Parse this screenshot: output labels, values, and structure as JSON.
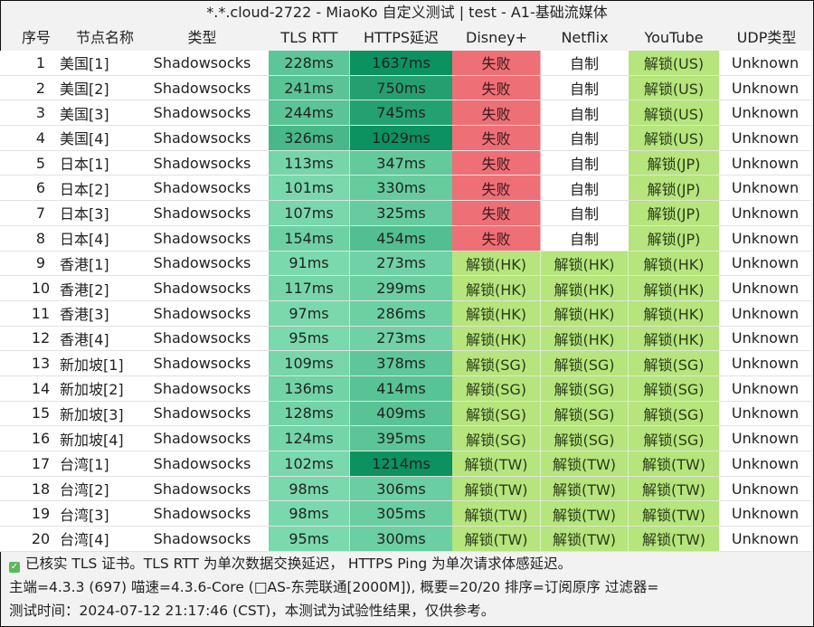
{
  "title": "*.*.cloud-2722 - MiaoKo 自定义测试 | test - A1-基础流媒体",
  "columns": [
    "序号",
    "节点名称",
    "类型",
    "TLS RTT",
    "HTTPS延迟",
    "Disney+",
    "Netflix",
    "YouTube",
    "UDP类型"
  ],
  "colors": {
    "fail": "#ef6f77",
    "unlock": "#b5e57c",
    "self_made": "#ffffff",
    "latency_low": "#7fdcb0",
    "latency_high": "#0c8f5e"
  },
  "rows": [
    {
      "idx": "1",
      "name": "美国[1]",
      "type": "Shadowsocks",
      "tls": "228ms",
      "tls_v": 228,
      "https": "1637ms",
      "https_v": 1637,
      "disney": "失败",
      "netflix": "自制",
      "youtube": "解锁(US)",
      "udp": "Unknown"
    },
    {
      "idx": "2",
      "name": "美国[2]",
      "type": "Shadowsocks",
      "tls": "241ms",
      "tls_v": 241,
      "https": "750ms",
      "https_v": 750,
      "disney": "失败",
      "netflix": "自制",
      "youtube": "解锁(US)",
      "udp": "Unknown"
    },
    {
      "idx": "3",
      "name": "美国[3]",
      "type": "Shadowsocks",
      "tls": "244ms",
      "tls_v": 244,
      "https": "745ms",
      "https_v": 745,
      "disney": "失败",
      "netflix": "自制",
      "youtube": "解锁(US)",
      "udp": "Unknown"
    },
    {
      "idx": "4",
      "name": "美国[4]",
      "type": "Shadowsocks",
      "tls": "326ms",
      "tls_v": 326,
      "https": "1029ms",
      "https_v": 1029,
      "disney": "失败",
      "netflix": "自制",
      "youtube": "解锁(US)",
      "udp": "Unknown"
    },
    {
      "idx": "5",
      "name": "日本[1]",
      "type": "Shadowsocks",
      "tls": "113ms",
      "tls_v": 113,
      "https": "347ms",
      "https_v": 347,
      "disney": "失败",
      "netflix": "自制",
      "youtube": "解锁(JP)",
      "udp": "Unknown"
    },
    {
      "idx": "6",
      "name": "日本[2]",
      "type": "Shadowsocks",
      "tls": "101ms",
      "tls_v": 101,
      "https": "330ms",
      "https_v": 330,
      "disney": "失败",
      "netflix": "自制",
      "youtube": "解锁(JP)",
      "udp": "Unknown"
    },
    {
      "idx": "7",
      "name": "日本[3]",
      "type": "Shadowsocks",
      "tls": "107ms",
      "tls_v": 107,
      "https": "325ms",
      "https_v": 325,
      "disney": "失败",
      "netflix": "自制",
      "youtube": "解锁(JP)",
      "udp": "Unknown"
    },
    {
      "idx": "8",
      "name": "日本[4]",
      "type": "Shadowsocks",
      "tls": "154ms",
      "tls_v": 154,
      "https": "454ms",
      "https_v": 454,
      "disney": "失败",
      "netflix": "自制",
      "youtube": "解锁(JP)",
      "udp": "Unknown"
    },
    {
      "idx": "9",
      "name": "香港[1]",
      "type": "Shadowsocks",
      "tls": "91ms",
      "tls_v": 91,
      "https": "273ms",
      "https_v": 273,
      "disney": "解锁(HK)",
      "netflix": "解锁(HK)",
      "youtube": "解锁(HK)",
      "udp": "Unknown"
    },
    {
      "idx": "10",
      "name": "香港[2]",
      "type": "Shadowsocks",
      "tls": "117ms",
      "tls_v": 117,
      "https": "299ms",
      "https_v": 299,
      "disney": "解锁(HK)",
      "netflix": "解锁(HK)",
      "youtube": "解锁(HK)",
      "udp": "Unknown"
    },
    {
      "idx": "11",
      "name": "香港[3]",
      "type": "Shadowsocks",
      "tls": "97ms",
      "tls_v": 97,
      "https": "286ms",
      "https_v": 286,
      "disney": "解锁(HK)",
      "netflix": "解锁(HK)",
      "youtube": "解锁(HK)",
      "udp": "Unknown"
    },
    {
      "idx": "12",
      "name": "香港[4]",
      "type": "Shadowsocks",
      "tls": "95ms",
      "tls_v": 95,
      "https": "273ms",
      "https_v": 273,
      "disney": "解锁(HK)",
      "netflix": "解锁(HK)",
      "youtube": "解锁(HK)",
      "udp": "Unknown"
    },
    {
      "idx": "13",
      "name": "新加坡[1]",
      "type": "Shadowsocks",
      "tls": "109ms",
      "tls_v": 109,
      "https": "378ms",
      "https_v": 378,
      "disney": "解锁(SG)",
      "netflix": "解锁(SG)",
      "youtube": "解锁(SG)",
      "udp": "Unknown"
    },
    {
      "idx": "14",
      "name": "新加坡[2]",
      "type": "Shadowsocks",
      "tls": "136ms",
      "tls_v": 136,
      "https": "414ms",
      "https_v": 414,
      "disney": "解锁(SG)",
      "netflix": "解锁(SG)",
      "youtube": "解锁(SG)",
      "udp": "Unknown"
    },
    {
      "idx": "15",
      "name": "新加坡[3]",
      "type": "Shadowsocks",
      "tls": "128ms",
      "tls_v": 128,
      "https": "409ms",
      "https_v": 409,
      "disney": "解锁(SG)",
      "netflix": "解锁(SG)",
      "youtube": "解锁(SG)",
      "udp": "Unknown"
    },
    {
      "idx": "16",
      "name": "新加坡[4]",
      "type": "Shadowsocks",
      "tls": "124ms",
      "tls_v": 124,
      "https": "395ms",
      "https_v": 395,
      "disney": "解锁(SG)",
      "netflix": "解锁(SG)",
      "youtube": "解锁(SG)",
      "udp": "Unknown"
    },
    {
      "idx": "17",
      "name": "台湾[1]",
      "type": "Shadowsocks",
      "tls": "102ms",
      "tls_v": 102,
      "https": "1214ms",
      "https_v": 1214,
      "disney": "解锁(TW)",
      "netflix": "解锁(TW)",
      "youtube": "解锁(TW)",
      "udp": "Unknown"
    },
    {
      "idx": "18",
      "name": "台湾[2]",
      "type": "Shadowsocks",
      "tls": "98ms",
      "tls_v": 98,
      "https": "306ms",
      "https_v": 306,
      "disney": "解锁(TW)",
      "netflix": "解锁(TW)",
      "youtube": "解锁(TW)",
      "udp": "Unknown"
    },
    {
      "idx": "19",
      "name": "台湾[3]",
      "type": "Shadowsocks",
      "tls": "98ms",
      "tls_v": 98,
      "https": "305ms",
      "https_v": 305,
      "disney": "解锁(TW)",
      "netflix": "解锁(TW)",
      "youtube": "解锁(TW)",
      "udp": "Unknown"
    },
    {
      "idx": "20",
      "name": "台湾[4]",
      "type": "Shadowsocks",
      "tls": "95ms",
      "tls_v": 95,
      "https": "300ms",
      "https_v": 300,
      "disney": "解锁(TW)",
      "netflix": "解锁(TW)",
      "youtube": "解锁(TW)",
      "udp": "Unknown"
    }
  ],
  "footer": {
    "check_icon": "checkbox-checked-icon",
    "line1": "已核实 TLS 证书。TLS RTT 为单次数据交换延迟， HTTPS Ping 为单次请求体感延迟。",
    "line2": "主端=4.3.3 (697) 喵速=4.3.6-Core (□AS-东莞联通[2000M]), 概要=20/20 排序=订阅原序 过滤器=",
    "line3": "测试时间：2024-07-12 21:17:46 (CST)，本测试为试验性结果，仅供参考。"
  }
}
